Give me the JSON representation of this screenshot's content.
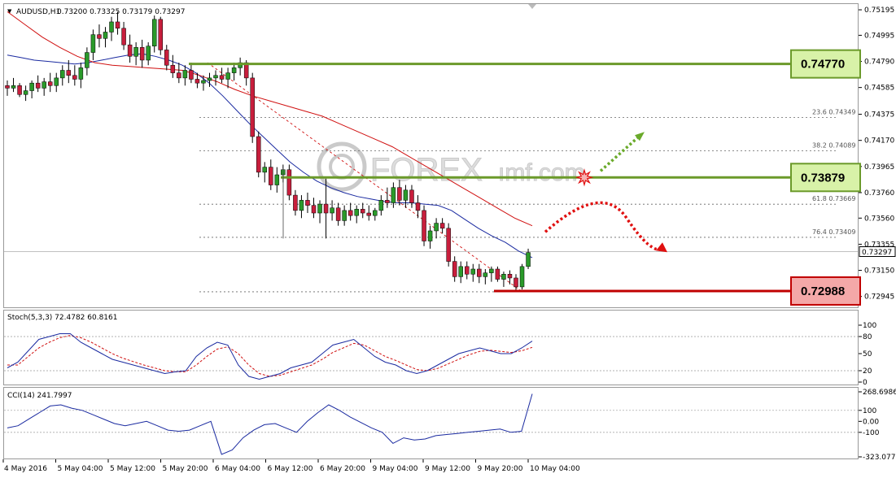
{
  "window": {
    "symbol_title": "AUDUSD,H1",
    "ohlc": "0.73200 0.73325 0.73179 0.73297",
    "watermark": "FOREX"
  },
  "chart_data": {
    "type": "candlestick",
    "symbol": "AUDUSD",
    "timeframe": "H1",
    "price_axis": {
      "ticks": [
        "0.75195",
        "0.74995",
        "0.74790",
        "0.74585",
        "0.74375",
        "0.74170",
        "0.73965",
        "0.73760",
        "0.73560",
        "0.73355",
        "0.73150",
        "0.72945"
      ],
      "range": [
        0.7286,
        0.7524
      ],
      "current_price": "0.73297"
    },
    "time_axis": {
      "labels": [
        "4 May 2016",
        "5 May 04:00",
        "5 May 12:00",
        "5 May 20:00",
        "6 May 04:00",
        "6 May 12:00",
        "6 May 20:00",
        "9 May 04:00",
        "9 May 12:00",
        "9 May 20:00",
        "10 May 04:00"
      ]
    },
    "candles": [
      [
        0.746,
        0.7464,
        0.7452,
        0.7458
      ],
      [
        0.7458,
        0.7466,
        0.7455,
        0.746
      ],
      [
        0.746,
        0.7462,
        0.7451,
        0.7453
      ],
      [
        0.7453,
        0.746,
        0.7448,
        0.7456
      ],
      [
        0.7456,
        0.7464,
        0.745,
        0.7462
      ],
      [
        0.7462,
        0.7468,
        0.7455,
        0.7458
      ],
      [
        0.7458,
        0.7466,
        0.7452,
        0.7463
      ],
      [
        0.7463,
        0.747,
        0.7455,
        0.746
      ],
      [
        0.746,
        0.747,
        0.7455,
        0.7466
      ],
      [
        0.7466,
        0.7476,
        0.746,
        0.7472
      ],
      [
        0.7472,
        0.748,
        0.7462,
        0.7468
      ],
      [
        0.7468,
        0.7476,
        0.746,
        0.7465
      ],
      [
        0.7465,
        0.7478,
        0.7458,
        0.7474
      ],
      [
        0.7474,
        0.749,
        0.7468,
        0.7486
      ],
      [
        0.7486,
        0.7504,
        0.748,
        0.75
      ],
      [
        0.75,
        0.7508,
        0.749,
        0.7497
      ],
      [
        0.7497,
        0.7506,
        0.749,
        0.7502
      ],
      [
        0.7502,
        0.7514,
        0.7495,
        0.751
      ],
      [
        0.751,
        0.7518,
        0.75,
        0.7505
      ],
      [
        0.7505,
        0.751,
        0.7488,
        0.7492
      ],
      [
        0.7492,
        0.75,
        0.7478,
        0.7483
      ],
      [
        0.7483,
        0.7494,
        0.7476,
        0.749
      ],
      [
        0.749,
        0.7496,
        0.7474,
        0.748
      ],
      [
        0.748,
        0.7494,
        0.7476,
        0.7491
      ],
      [
        0.7491,
        0.7515,
        0.7486,
        0.7512
      ],
      [
        0.7512,
        0.7514,
        0.7484,
        0.7488
      ],
      [
        0.7488,
        0.7492,
        0.7472,
        0.7476
      ],
      [
        0.7476,
        0.7484,
        0.7466,
        0.747
      ],
      [
        0.747,
        0.7478,
        0.7462,
        0.7466
      ],
      [
        0.7466,
        0.7476,
        0.746,
        0.7472
      ],
      [
        0.7472,
        0.7478,
        0.7462,
        0.7465
      ],
      [
        0.7465,
        0.747,
        0.7458,
        0.7462
      ],
      [
        0.7462,
        0.7468,
        0.7456,
        0.7464
      ],
      [
        0.7464,
        0.747,
        0.7459,
        0.7466
      ],
      [
        0.7466,
        0.7472,
        0.746,
        0.7468
      ],
      [
        0.7468,
        0.7474,
        0.7462,
        0.7465
      ],
      [
        0.7465,
        0.7474,
        0.7458,
        0.747
      ],
      [
        0.747,
        0.7478,
        0.7464,
        0.7474
      ],
      [
        0.7474,
        0.7482,
        0.7468,
        0.7478
      ],
      [
        0.7478,
        0.748,
        0.746,
        0.7466
      ],
      [
        0.7466,
        0.747,
        0.7415,
        0.742
      ],
      [
        0.742,
        0.7424,
        0.7388,
        0.7392
      ],
      [
        0.7392,
        0.74,
        0.7384,
        0.7396
      ],
      [
        0.7396,
        0.7402,
        0.7378,
        0.7382
      ],
      [
        0.7382,
        0.7396,
        0.7376,
        0.739
      ],
      [
        0.739,
        0.7398,
        0.7384,
        0.7394
      ],
      [
        0.7394,
        0.7398,
        0.737,
        0.7374
      ],
      [
        0.7374,
        0.7378,
        0.7358,
        0.7362
      ],
      [
        0.7362,
        0.7374,
        0.7356,
        0.737
      ],
      [
        0.737,
        0.7376,
        0.736,
        0.7366
      ],
      [
        0.7366,
        0.7372,
        0.7356,
        0.736
      ],
      [
        0.736,
        0.737,
        0.7352,
        0.7367
      ],
      [
        0.7367,
        0.7387,
        0.734,
        0.736
      ],
      [
        0.736,
        0.737,
        0.7354,
        0.7364
      ],
      [
        0.7364,
        0.7368,
        0.735,
        0.7354
      ],
      [
        0.7354,
        0.7366,
        0.735,
        0.7362
      ],
      [
        0.7362,
        0.7368,
        0.7354,
        0.7358
      ],
      [
        0.7358,
        0.7366,
        0.7352,
        0.7363
      ],
      [
        0.7363,
        0.7368,
        0.7356,
        0.736
      ],
      [
        0.736,
        0.7366,
        0.7354,
        0.7358
      ],
      [
        0.7358,
        0.7364,
        0.7354,
        0.7362
      ],
      [
        0.7362,
        0.7374,
        0.7358,
        0.737
      ],
      [
        0.737,
        0.738,
        0.7364,
        0.7368
      ],
      [
        0.7368,
        0.7384,
        0.7364,
        0.738
      ],
      [
        0.738,
        0.7386,
        0.7366,
        0.737
      ],
      [
        0.737,
        0.7382,
        0.7364,
        0.7378
      ],
      [
        0.7378,
        0.7382,
        0.7364,
        0.7368
      ],
      [
        0.7368,
        0.7374,
        0.7356,
        0.7362
      ],
      [
        0.7362,
        0.7366,
        0.7334,
        0.7338
      ],
      [
        0.7338,
        0.735,
        0.7332,
        0.7346
      ],
      [
        0.7346,
        0.7356,
        0.734,
        0.7352
      ],
      [
        0.7352,
        0.7356,
        0.7344,
        0.7348
      ],
      [
        0.7348,
        0.7352,
        0.7318,
        0.7322
      ],
      [
        0.7322,
        0.7326,
        0.7306,
        0.731
      ],
      [
        0.731,
        0.7322,
        0.7305,
        0.7318
      ],
      [
        0.7318,
        0.7322,
        0.7308,
        0.7312
      ],
      [
        0.7312,
        0.732,
        0.7306,
        0.7316
      ],
      [
        0.7316,
        0.732,
        0.7305,
        0.731
      ],
      [
        0.731,
        0.7316,
        0.7304,
        0.7313
      ],
      [
        0.7313,
        0.7318,
        0.7306,
        0.7316
      ],
      [
        0.7316,
        0.7318,
        0.7306,
        0.7308
      ],
      [
        0.7308,
        0.7314,
        0.7302,
        0.7312
      ],
      [
        0.7312,
        0.7315,
        0.7304,
        0.7309
      ],
      [
        0.7309,
        0.7312,
        0.7298,
        0.7302
      ],
      [
        0.7302,
        0.732,
        0.73,
        0.7318
      ],
      [
        0.7318,
        0.7332,
        0.7316,
        0.7329
      ]
    ],
    "ma_blue": [
      0.7484,
      0.7482,
      0.748,
      0.7479,
      0.7478,
      0.7477,
      0.7478,
      0.748,
      0.7482,
      0.7484,
      0.7485,
      0.7483,
      0.748,
      0.7476,
      0.747,
      0.7462,
      0.7452,
      0.7441,
      0.743,
      0.742,
      0.741,
      0.74,
      0.7392,
      0.7385,
      0.738,
      0.7376,
      0.7373,
      0.7371,
      0.7369,
      0.7368,
      0.7368,
      0.7367,
      0.7366,
      0.7362,
      0.7355,
      0.7348,
      0.7342,
      0.7337,
      0.733,
      0.7325
    ],
    "ma_red": [
      0.7518,
      0.7508,
      0.7498,
      0.749,
      0.7483,
      0.7478,
      0.7476,
      0.7475,
      0.7474,
      0.7473,
      0.7472,
      0.7468,
      0.7463,
      0.7457,
      0.7452,
      0.7448,
      0.7444,
      0.744,
      0.7436,
      0.743,
      0.7424,
      0.7418,
      0.7412,
      0.7404,
      0.7396,
      0.7388,
      0.738,
      0.7372,
      0.7364,
      0.7356,
      0.735
    ],
    "fibonacci": [
      {
        "ratio": "23.6",
        "price": "0.74349"
      },
      {
        "ratio": "38.2",
        "price": "0.74089"
      },
      {
        "ratio": "61.8",
        "price": "0.73669"
      },
      {
        "ratio": "76.4",
        "price": "0.73409"
      }
    ],
    "levels": [
      {
        "value": "0.74770",
        "price": 0.7477,
        "color": "#6b9a2a",
        "box_fill": "#d8f2a8",
        "role": "resistance"
      },
      {
        "value": "0.73879",
        "price": 0.73879,
        "color": "#6b9a2a",
        "box_fill": "#d8f2a8",
        "role": "resistance"
      },
      {
        "value": "0.72988",
        "price": 0.72988,
        "color": "#c00000",
        "box_fill": "#f4a8a8",
        "role": "support"
      }
    ],
    "stochastic": {
      "label": "Stoch(5,3,3) 72.4782 60.8161",
      "range": [
        0,
        100
      ],
      "ticks": [
        "100",
        "80",
        "50",
        "20",
        "0"
      ],
      "k": [
        25,
        35,
        55,
        75,
        80,
        85,
        85,
        70,
        60,
        50,
        40,
        35,
        30,
        25,
        20,
        15,
        18,
        20,
        45,
        60,
        70,
        65,
        30,
        10,
        5,
        10,
        15,
        25,
        30,
        35,
        50,
        65,
        70,
        75,
        60,
        45,
        35,
        30,
        20,
        15,
        20,
        30,
        40,
        50,
        55,
        60,
        55,
        50,
        50,
        60,
        72
      ],
      "d": [
        30,
        30,
        45,
        60,
        70,
        78,
        82,
        78,
        70,
        60,
        50,
        42,
        36,
        30,
        25,
        20,
        18,
        18,
        30,
        45,
        58,
        62,
        50,
        30,
        15,
        10,
        12,
        18,
        24,
        30,
        40,
        52,
        60,
        68,
        65,
        55,
        45,
        38,
        30,
        22,
        20,
        24,
        32,
        40,
        48,
        54,
        56,
        54,
        52,
        55,
        61
      ]
    },
    "cci": {
      "label": "CCI(14) 241.7997",
      "ticks": [
        "268.6986",
        "100",
        "0.00",
        "-100",
        "-323.0779"
      ],
      "range": [
        -323.0779,
        268.6986
      ],
      "values": [
        -60,
        -40,
        20,
        80,
        140,
        150,
        120,
        100,
        60,
        20,
        -20,
        -40,
        -20,
        0,
        -40,
        -80,
        -90,
        -80,
        -40,
        0,
        -300,
        -260,
        -150,
        -80,
        -30,
        -20,
        -60,
        -100,
        0,
        80,
        150,
        100,
        40,
        -10,
        -60,
        -100,
        -200,
        -150,
        -170,
        -160,
        -130,
        -120,
        -110,
        -100,
        -90,
        -80,
        -70,
        -100,
        -90,
        250
      ]
    }
  },
  "colors": {
    "bull": "#2a9a2a",
    "bear": "#c81e3c",
    "ma_blue": "#1a2aa0",
    "ma_red": "#d01010",
    "stoch_d": "#d01010",
    "cci_line": "#1a2aa0",
    "green_level": "#6b9a2a",
    "red_level": "#c00000"
  }
}
